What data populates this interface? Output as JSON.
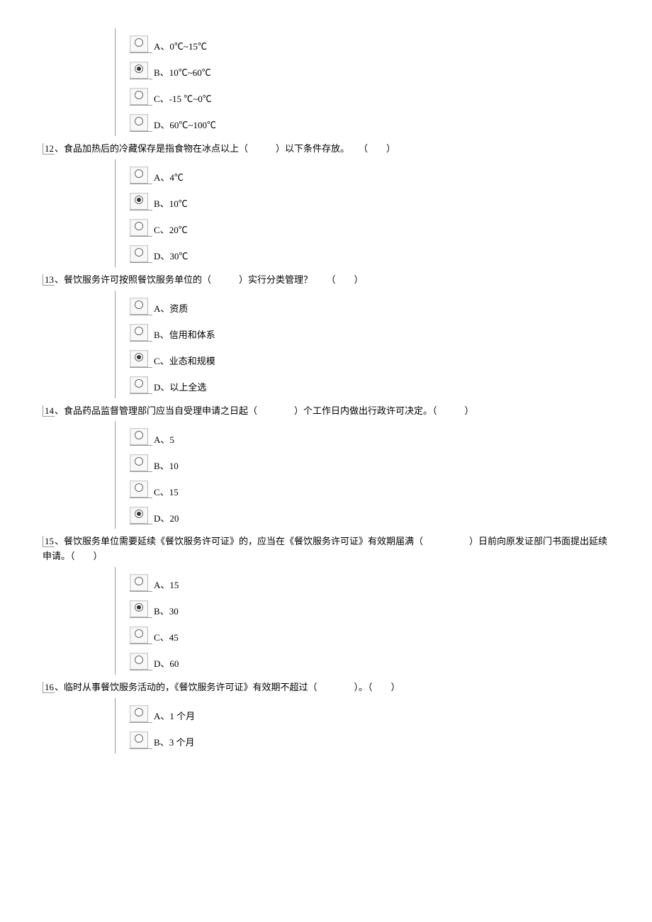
{
  "questions": [
    {
      "number": "",
      "text": "",
      "options": [
        {
          "letter": "A",
          "text": "0℃~15℃",
          "selected": false
        },
        {
          "letter": "B",
          "text": "10℃~60℃",
          "selected": true
        },
        {
          "letter": "C",
          "text": "-15 ℃~0℃",
          "selected": false
        },
        {
          "letter": "D",
          "text": "60℃~100℃",
          "selected": false
        }
      ]
    },
    {
      "number": "12",
      "text": "、食品加热后的冷藏保存是指食物在冰点以上（　　　）以下条件存放。　　（　　）",
      "options": [
        {
          "letter": "A",
          "text": "4℃",
          "selected": false
        },
        {
          "letter": "B",
          "text": "10℃",
          "selected": true
        },
        {
          "letter": "C",
          "text": "20℃",
          "selected": false
        },
        {
          "letter": "D",
          "text": "30℃",
          "selected": false
        }
      ]
    },
    {
      "number": "13",
      "text": "、餐饮服务许可按照餐饮服务单位的（　　　）实行分类管理？　　（　　）",
      "options": [
        {
          "letter": "A",
          "text": "资质",
          "selected": false
        },
        {
          "letter": "B",
          "text": "信用和体系",
          "selected": false
        },
        {
          "letter": "C",
          "text": "业态和规模",
          "selected": true
        },
        {
          "letter": "D",
          "text": "以上全选",
          "selected": false
        }
      ]
    },
    {
      "number": "14",
      "text": "、食品药品监督管理部门应当自受理申请之日起（　　　　）个工作日内做出行政许可决定。（　　　）",
      "options": [
        {
          "letter": "A",
          "text": "5",
          "selected": false
        },
        {
          "letter": "B",
          "text": "10",
          "selected": false
        },
        {
          "letter": "C",
          "text": "15",
          "selected": false
        },
        {
          "letter": "D",
          "text": "20",
          "selected": true
        }
      ]
    },
    {
      "number": "15",
      "text": "、餐饮服务单位需要延续《餐饮服务许可证》的，应当在《餐饮服务许可证》有效期届满（　　　　　）日前向原发证部门书面提出延续申请。（　　）",
      "options": [
        {
          "letter": "A",
          "text": "15",
          "selected": false
        },
        {
          "letter": "B",
          "text": "30",
          "selected": true
        },
        {
          "letter": "C",
          "text": "45",
          "selected": false
        },
        {
          "letter": "D",
          "text": "60",
          "selected": false
        }
      ]
    },
    {
      "number": "16",
      "text": "、临时从事餐饮服务活动的，《餐饮服务许可证》有效期不超过（　　　　）。（　　）",
      "options": [
        {
          "letter": "A",
          "text": "1 个月",
          "selected": false
        },
        {
          "letter": "B",
          "text": "3 个月",
          "selected": false
        }
      ]
    }
  ]
}
